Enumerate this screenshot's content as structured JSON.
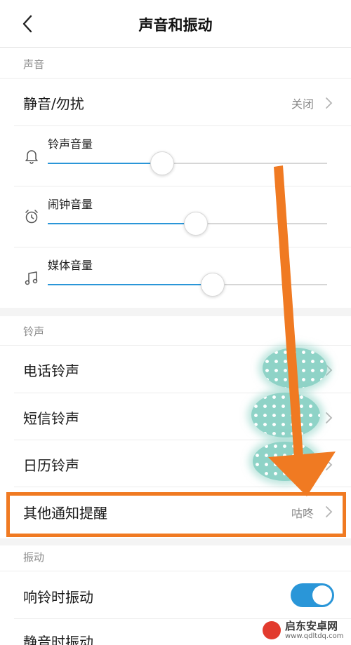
{
  "header": {
    "title": "声音和振动"
  },
  "sections": {
    "sound": "声音",
    "ringtone": "铃声",
    "vibration": "振动"
  },
  "silent": {
    "label": "静音/勿扰",
    "value": "关闭"
  },
  "volumes": {
    "ringer": {
      "label": "铃声音量",
      "icon": "bell-icon",
      "level": 0.41
    },
    "alarm": {
      "label": "闹钟音量",
      "icon": "alarm-clock-icon",
      "level": 0.53
    },
    "media": {
      "label": "媒体音量",
      "icon": "music-note-icon",
      "level": 0.59
    }
  },
  "ringtones": {
    "phone": {
      "label": "电话铃声"
    },
    "sms": {
      "label": "短信铃声"
    },
    "calendar": {
      "label": "日历铃声"
    },
    "other": {
      "label": "其他通知提醒",
      "value": "咕咚"
    }
  },
  "vibrate": {
    "ring_label": "响铃时振动",
    "ring_on": true,
    "next_label": "静音时振动"
  },
  "colors": {
    "accent": "#2a96d8",
    "annotation": "#f07a22",
    "blob": "#8fd3c7"
  },
  "watermark": {
    "name": "启东安卓网",
    "url": "www.qdltdq.com"
  }
}
